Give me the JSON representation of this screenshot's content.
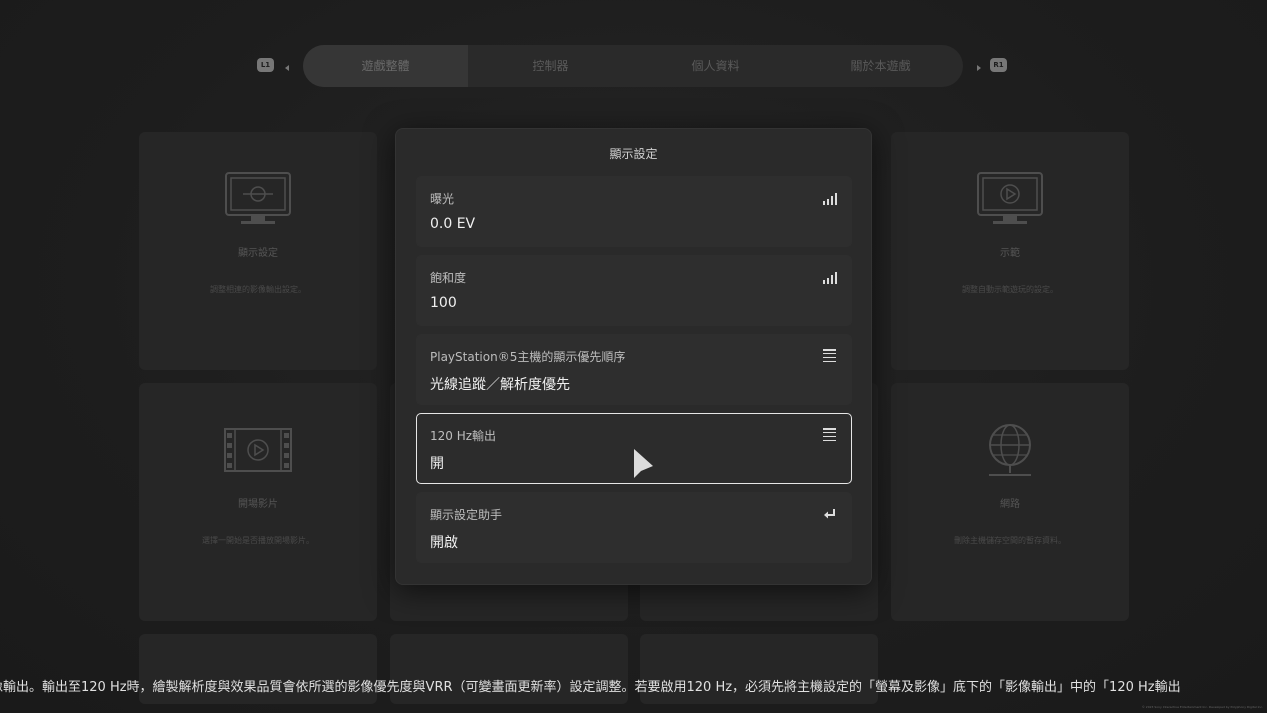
{
  "tabs": {
    "l1_label": "L1",
    "r1_label": "R1",
    "items": [
      "遊戲整體",
      "控制器",
      "個人資料",
      "關於本遊戲"
    ]
  },
  "cards": {
    "display": {
      "title": "顯示設定",
      "desc": "調整相連的影像輸出設定。"
    },
    "demo": {
      "title": "示範",
      "desc": "調整自動示範遊玩的設定。"
    },
    "opening": {
      "title": "開場影片",
      "desc": "選擇一開始是否播放開場影片。"
    },
    "network": {
      "title": "網路",
      "desc": "刪除主機儲存空間的暫存資料。"
    }
  },
  "panel": {
    "title": "顯示設定",
    "rows": [
      {
        "label": "曝光",
        "value": "0.0 EV",
        "icon": "signal-bars-icon"
      },
      {
        "label": "飽和度",
        "value": "100",
        "icon": "signal-bars-icon"
      },
      {
        "label": "PlayStation®5主機的顯示優先順序",
        "value": "光線追蹤／解析度優先",
        "icon": "list-icon"
      },
      {
        "label": "120 Hz輸出",
        "value": "開",
        "icon": "list-icon"
      },
      {
        "label": "顯示設定助手",
        "value": "開啟",
        "icon": "enter-icon"
      }
    ]
  },
  "ticker": "像輸出。輸出至120 Hz時，繪製解析度與效果品質會依所選的影像優先度與VRR（可變畫面更新率）設定調整。若要啟用120 Hz，必須先將主機設定的「螢幕及影像」底下的「影像輸出」中的「120 Hz輸出",
  "copyright": "© 2023 Sony Interactive Entertainment Inc. Developed by Polyphony Digital Inc."
}
